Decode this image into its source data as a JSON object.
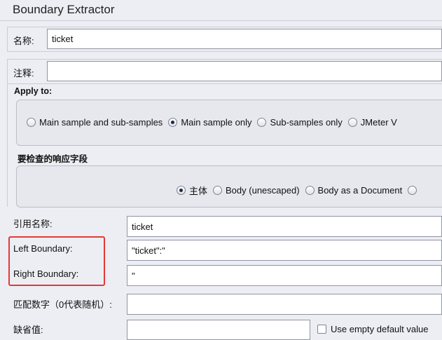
{
  "panel": {
    "title": "Boundary Extractor"
  },
  "name_field": {
    "label": "名称:",
    "value": "ticket"
  },
  "comment_field": {
    "label": "注释:",
    "value": ""
  },
  "apply_to": {
    "label": "Apply to:",
    "options": [
      "Main sample and sub-samples",
      "Main sample only",
      "Sub-samples only",
      "JMeter V"
    ],
    "selected": "Main sample only"
  },
  "field_to_check": {
    "label": "要检查的响应字段",
    "options": [
      "主体",
      "Body (unescaped)",
      "Body as a Document"
    ],
    "selected": "主体"
  },
  "reference_name": {
    "label": "引用名称:",
    "value": "ticket"
  },
  "left_boundary": {
    "label": "Left Boundary:",
    "value": "\"ticket\":\""
  },
  "right_boundary": {
    "label": "Right Boundary:",
    "value": "\""
  },
  "match_no": {
    "label": "匹配数字（0代表随机）:",
    "value": ""
  },
  "default_value": {
    "label": "缺省值:",
    "value": ""
  },
  "use_empty_default": {
    "label": "Use empty default value",
    "checked": false
  },
  "colors": {
    "highlight": "#e53935"
  }
}
